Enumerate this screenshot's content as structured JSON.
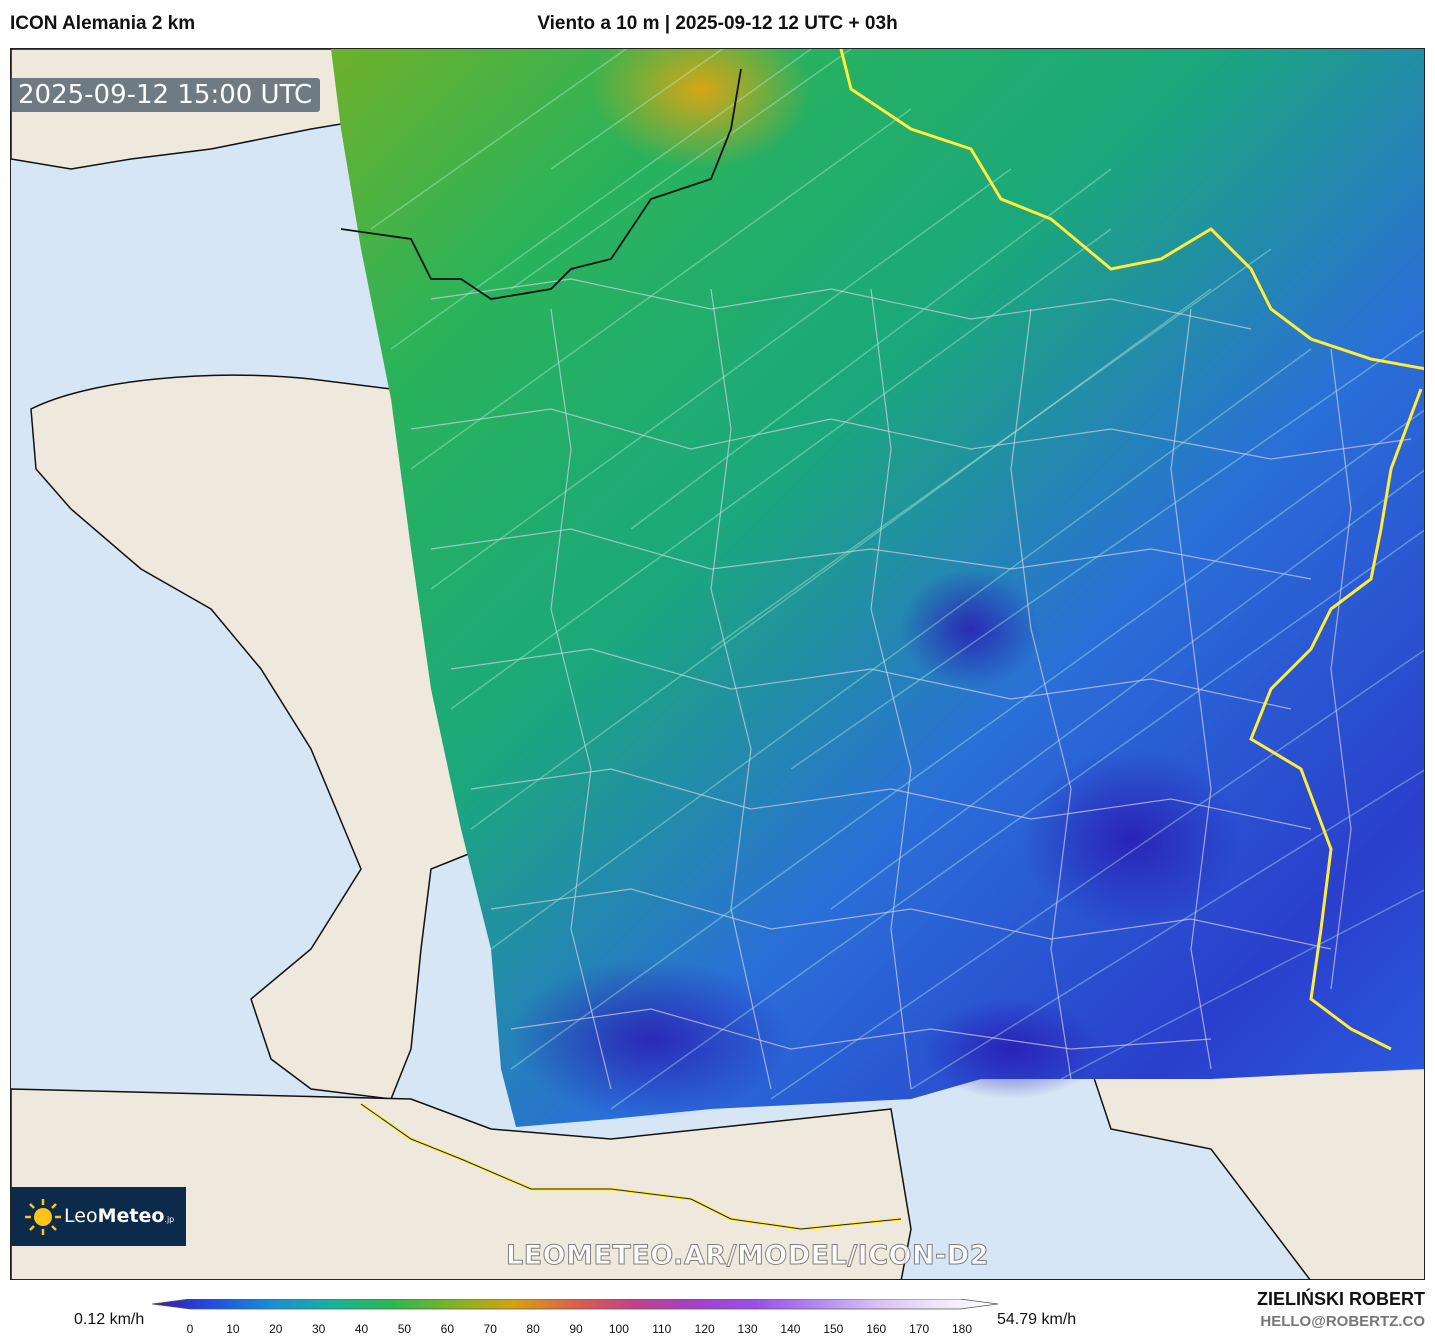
{
  "header": {
    "model_title": "ICON Alemania 2 km",
    "chart_title": "Viento a 10 m | 2025-09-12 12 UTC + 03h"
  },
  "map": {
    "valid_time": "2025-09-12 15:00 UTC",
    "watermark": "LEOMETEO.AR/MODEL/ICON-D2",
    "region": "France",
    "ocean_color": "#d6e6f5",
    "land_color": "#efe8dc",
    "wind_direction": "south-west to north-east flow"
  },
  "logo": {
    "brand_prefix": "Leo",
    "brand_bold": "Meteo",
    "brand_suffix": ".jp"
  },
  "colorbar": {
    "min_label": "0.12 km/h",
    "max_label": "54.79 km/h",
    "ticks": [
      "0",
      "10",
      "20",
      "30",
      "40",
      "50",
      "60",
      "70",
      "80",
      "90",
      "100",
      "110",
      "120",
      "130",
      "140",
      "150",
      "160",
      "170",
      "180"
    ],
    "colors": [
      "#3b14b8",
      "#1f4ee0",
      "#1a8fd6",
      "#17b39a",
      "#2db84c",
      "#7fb325",
      "#d6a10f",
      "#d9604a",
      "#c0428a",
      "#a440c8",
      "#9a50e8",
      "#b388f0",
      "#d8c0f5",
      "#efe6fa",
      "#ffffff"
    ]
  },
  "credits": {
    "author": "ZIELIŃSKI ROBERT",
    "email": "HELLO@ROBERTZ.CO"
  }
}
